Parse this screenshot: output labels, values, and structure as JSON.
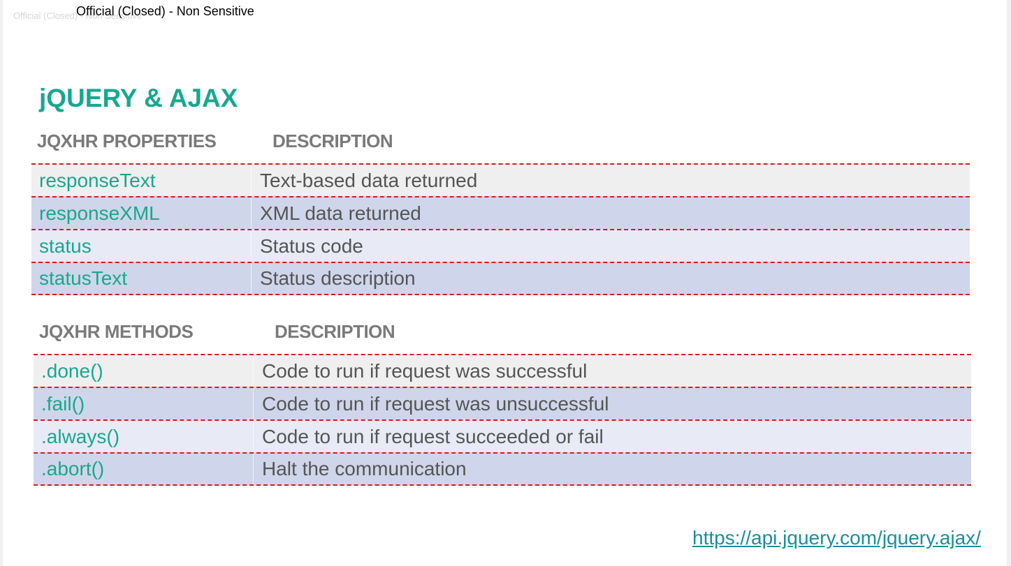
{
  "classification": {
    "ghost_label": "Official (Closed) - Non Sensitive",
    "main_label": "Official (Closed) - Non Sensitive"
  },
  "slide": {
    "title": "jQUERY & AJAX",
    "properties_table": {
      "header_left": "JQXHR PROPERTIES",
      "header_right": "DESCRIPTION",
      "rows": [
        {
          "name": "responseText",
          "description": "Text-based data returned"
        },
        {
          "name": "responseXML",
          "description": "XML data returned"
        },
        {
          "name": "status",
          "description": "Status code"
        },
        {
          "name": "statusText",
          "description": "Status description"
        }
      ]
    },
    "methods_table": {
      "header_left": "JQXHR METHODS",
      "header_right": "DESCRIPTION",
      "rows": [
        {
          "name": ".done()",
          "description": "Code to run if request was successful"
        },
        {
          "name": ".fail()",
          "description": "Code to run if request was unsuccessful"
        },
        {
          "name": ".always()",
          "description": "Code to run if request succeeded or fail"
        },
        {
          "name": ".abort()",
          "description": "Halt the communication"
        }
      ]
    },
    "reference_link": "https://api.jquery.com/jquery.ajax/"
  },
  "colors": {
    "accent_teal": "#17a88f",
    "divider_red": "#e0161b",
    "row_gray": "#efefef",
    "row_blue": "#cfd5ea",
    "row_light": "#e8eaf6"
  }
}
